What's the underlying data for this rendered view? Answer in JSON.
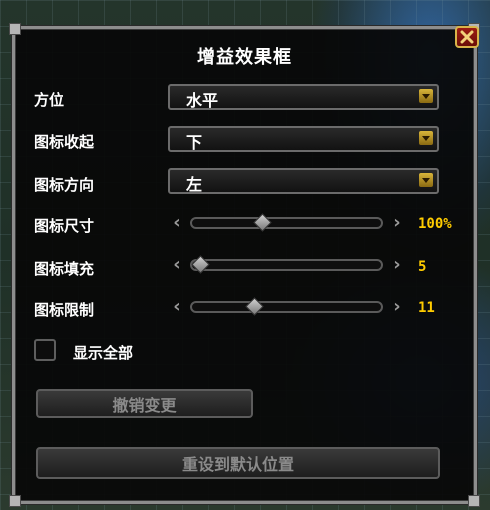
{
  "title": "增益效果框",
  "close_icon": "close-x-icon",
  "rows": [
    {
      "label": "方位",
      "type": "dropdown",
      "value": "水平"
    },
    {
      "label": "图标收起",
      "type": "dropdown",
      "value": "下"
    },
    {
      "label": "图标方向",
      "type": "dropdown",
      "value": "左"
    },
    {
      "label": "图标尺寸",
      "type": "slider",
      "value": "100%",
      "position": 0.36
    },
    {
      "label": "图标填充",
      "type": "slider",
      "value": "5",
      "position": 0.0
    },
    {
      "label": "图标限制",
      "type": "slider",
      "value": "11",
      "position": 0.31
    }
  ],
  "checkbox": {
    "label": "显示全部",
    "checked": false
  },
  "buttons": {
    "revert": "撤销变更",
    "reset": "重设到默认位置"
  },
  "colors": {
    "accent_value": "#ffcc00",
    "close_button": "#9c1b12",
    "panel_border": "#8d8d8d"
  }
}
